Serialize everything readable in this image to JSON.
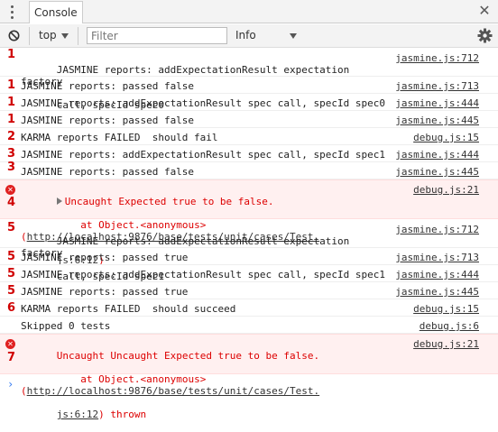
{
  "tabs": {
    "console_label": "Console"
  },
  "toolbar": {
    "context": "top",
    "filter_placeholder": "Filter",
    "level": "Info"
  },
  "messages": [
    {
      "num": "1",
      "line1": "JASMINE reports: addExpectationResult expectation factory",
      "line2": "call, specId spec0",
      "source": "jasmine.js:712"
    },
    {
      "num": "1",
      "line1": "JASMINE reports: passed false",
      "source": "jasmine.js:713"
    },
    {
      "num": "1",
      "line1": "JASMINE reports: addExpectationResult spec call, specId spec0",
      "source": "jasmine.js:444"
    },
    {
      "num": "1",
      "line1": "JASMINE reports: passed false",
      "source": "jasmine.js:445"
    },
    {
      "num": "2",
      "line1": "KARMA reports FAILED  should fail",
      "source": "debug.js:15"
    },
    {
      "num": "3",
      "line1": "JASMINE reports: addExpectationResult spec call, specId spec1",
      "source": "jasmine.js:444"
    },
    {
      "num": "3",
      "line1": "JASMINE reports: passed false",
      "source": "jasmine.js:445"
    }
  ],
  "error1": {
    "num": "4",
    "line1": "Uncaught Expected true to be false.",
    "line2_prefix": "    at Object.<anonymous> (",
    "link_a": "http://localhost:9876/base/tests/unit/cases/Test.",
    "link_b": "js:6:12",
    "line3_suffix": ")",
    "source": "debug.js:21"
  },
  "messages2": [
    {
      "num": "5",
      "line1": "JASMINE reports: addExpectationResult expectation factory",
      "line2": "call, specId spec1",
      "source": "jasmine.js:712"
    },
    {
      "num": "5",
      "line1": "JASMINE reports: passed true",
      "source": "jasmine.js:713"
    },
    {
      "num": "5",
      "line1": "JASMINE reports: addExpectationResult spec call, specId spec1",
      "source": "jasmine.js:444"
    },
    {
      "num": "5",
      "line1": "JASMINE reports: passed true",
      "source": "jasmine.js:445"
    },
    {
      "num": "6",
      "line1": "KARMA reports FAILED  should succeed",
      "source": "debug.js:15"
    },
    {
      "num": "",
      "line1": "Skipped 0 tests",
      "source": "debug.js:6"
    }
  ],
  "error2": {
    "num": "7",
    "line1": "Uncaught Uncaught Expected true to be false.",
    "line2_prefix": "    at Object.<anonymous> (",
    "link_a": "http://localhost:9876/base/tests/unit/cases/Test.",
    "link_b": "js:6:12",
    "line3_suffix": ") thrown",
    "source": "debug.js:21"
  },
  "prompt": "›",
  "colors": {
    "annotation": "#d00000",
    "error_bg": "#fff0f0",
    "prompt": "#367cf1"
  },
  "icons": {
    "menu": "kebab-icon",
    "close": "close-icon",
    "clear": "clear-console-icon",
    "settings": "gear-icon",
    "error": "error-icon"
  }
}
